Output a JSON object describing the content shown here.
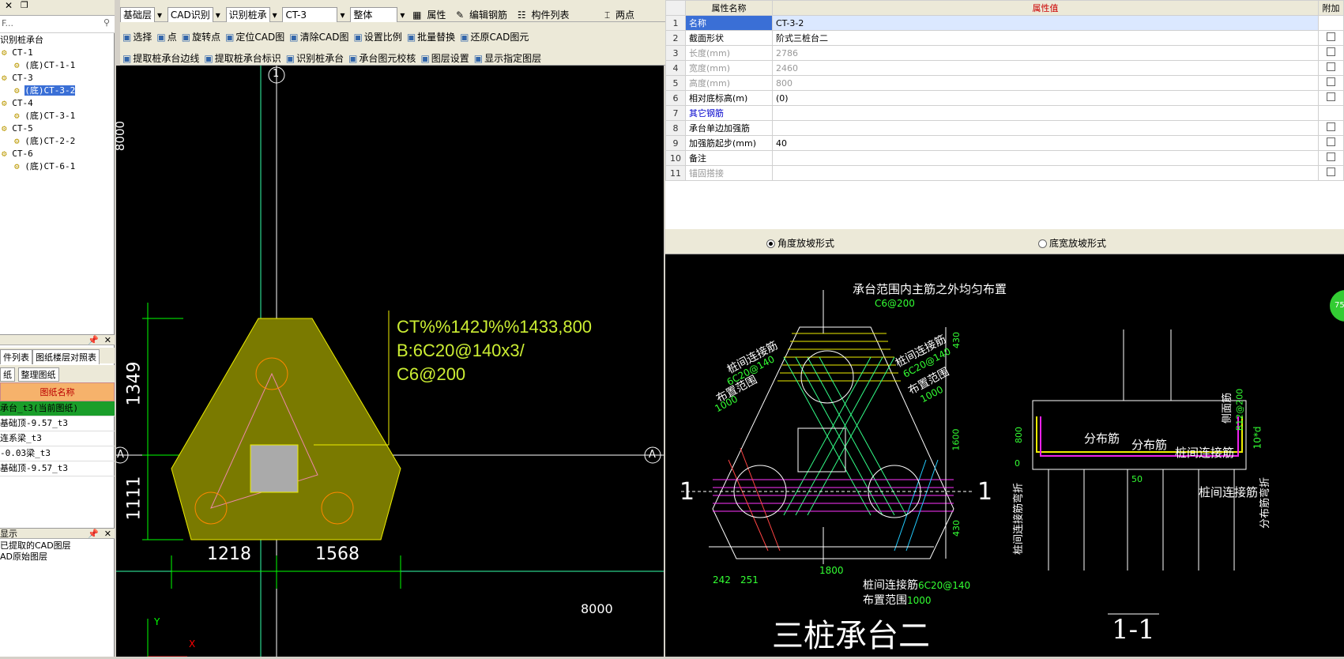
{
  "left": {
    "search_placeholder": "F...",
    "tree_root": "识别桩承台",
    "tree": [
      {
        "label": "CT-1",
        "level": 0
      },
      {
        "label": "(底)CT-1-1",
        "level": 1
      },
      {
        "label": "CT-3",
        "level": 0
      },
      {
        "label": "(底)CT-3-2",
        "level": 1,
        "selected": true
      },
      {
        "label": "CT-4",
        "level": 0
      },
      {
        "label": "(底)CT-3-1",
        "level": 1
      },
      {
        "label": "CT-5",
        "level": 0
      },
      {
        "label": "(底)CT-2-2",
        "level": 1
      },
      {
        "label": "CT-6",
        "level": 0
      },
      {
        "label": "(底)CT-6-1",
        "level": 1
      }
    ],
    "tabs": [
      "件列表",
      "图纸楼层对照表"
    ],
    "sheet_tools": [
      "纸",
      "整理图纸"
    ],
    "sheet_header": "图纸名称",
    "sheets": [
      {
        "name": "承台_t3(当前图纸)",
        "current": true
      },
      {
        "name": "基础顶-9.57_t3"
      },
      {
        "name": "连系梁_t3"
      },
      {
        "name": "-0.03梁_t3"
      },
      {
        "name": "基础顶-9.57_t3"
      }
    ],
    "display_title": "显示",
    "display_items": [
      "已提取的CAD图层",
      "AD原始图层"
    ]
  },
  "toolbar1": {
    "floor": "基础层",
    "mode": "CAD识别",
    "recog": "识别桩承",
    "comp": "CT-3",
    "scope": "整体",
    "props": "属性",
    "edit_rebar": "编辑钢筋",
    "comp_list": "构件列表",
    "two_point": "两点"
  },
  "toolbar2": [
    "选择",
    "点",
    "旋转点",
    "定位CAD图",
    "清除CAD图",
    "设置比例",
    "批量替换",
    "还原CAD图元"
  ],
  "toolbar3": [
    "提取桩承台边线",
    "提取桩承台标识",
    "识别桩承台",
    "承台图元校核",
    "图层设置",
    "显示指定图层"
  ],
  "cad": {
    "label_line1": "CT%%142J%%1433,800",
    "label_line2": "B:6C20@140x3/",
    "label_line3": "C6@200",
    "dim_8000_v": "8000",
    "dim_1349": "1349",
    "dim_1111": "1111",
    "dim_1218": "1218",
    "dim_1568": "1568",
    "dim_8000_h": "8000",
    "axis_1": "1",
    "axis_a": "A",
    "ucs_y": "Y",
    "ucs_x": "X"
  },
  "props": {
    "header_name": "属性名称",
    "header_value": "属性值",
    "header_extra": "附加",
    "rows": [
      {
        "n": "1",
        "name": "名称",
        "value": "CT-3-2",
        "style": "sel"
      },
      {
        "n": "2",
        "name": "截面形状",
        "value": "阶式三桩台二"
      },
      {
        "n": "3",
        "name": "长度(mm)",
        "value": "2786",
        "style": "grey"
      },
      {
        "n": "4",
        "name": "宽度(mm)",
        "value": "2460",
        "style": "grey"
      },
      {
        "n": "5",
        "name": "高度(mm)",
        "value": "800",
        "style": "grey"
      },
      {
        "n": "6",
        "name": "相对底标高(m)",
        "value": "(0)"
      },
      {
        "n": "7",
        "name": "其它钢筋",
        "value": "",
        "style": "blue"
      },
      {
        "n": "8",
        "name": "承台单边加强筋",
        "value": ""
      },
      {
        "n": "9",
        "name": "加强筋起步(mm)",
        "value": "40"
      },
      {
        "n": "10",
        "name": "备注",
        "value": ""
      },
      {
        "n": "11",
        "name": "锚固搭接",
        "value": "",
        "style": "grey"
      }
    ]
  },
  "radio": {
    "opt1": "角度放坡形式",
    "opt2": "底宽放坡形式"
  },
  "diag": {
    "note_top": "承台范围内主筋之外均匀布置",
    "c6": "C6@200",
    "pile_link": "桩间连接筋",
    "pile_link_spec": "6C20@140",
    "layout_range": "布置范围",
    "range_1000": "1000",
    "dim_430a": "430",
    "dim_1600": "1600",
    "dim_430b": "430",
    "dim_1800": "1800",
    "dim_242": "242",
    "dim_251": "251",
    "bottom_link": "桩间连接筋",
    "bottom_spec": "6C20@140",
    "bottom_range": "布置范围",
    "bottom_1000": "1000",
    "title": "三桩承台二",
    "sec_mark": "1",
    "sec_title": "1-1",
    "dist_bar": "分布筋",
    "side_bar": "侧面筋",
    "side_spec": "B12@200",
    "dim_800": "800",
    "dim_0": "0",
    "dim_50": "50",
    "dim_10d": "10*d",
    "left_vert": "桩间连接筋弯折",
    "right_vert": "分布筋弯折",
    "badge": "75"
  }
}
